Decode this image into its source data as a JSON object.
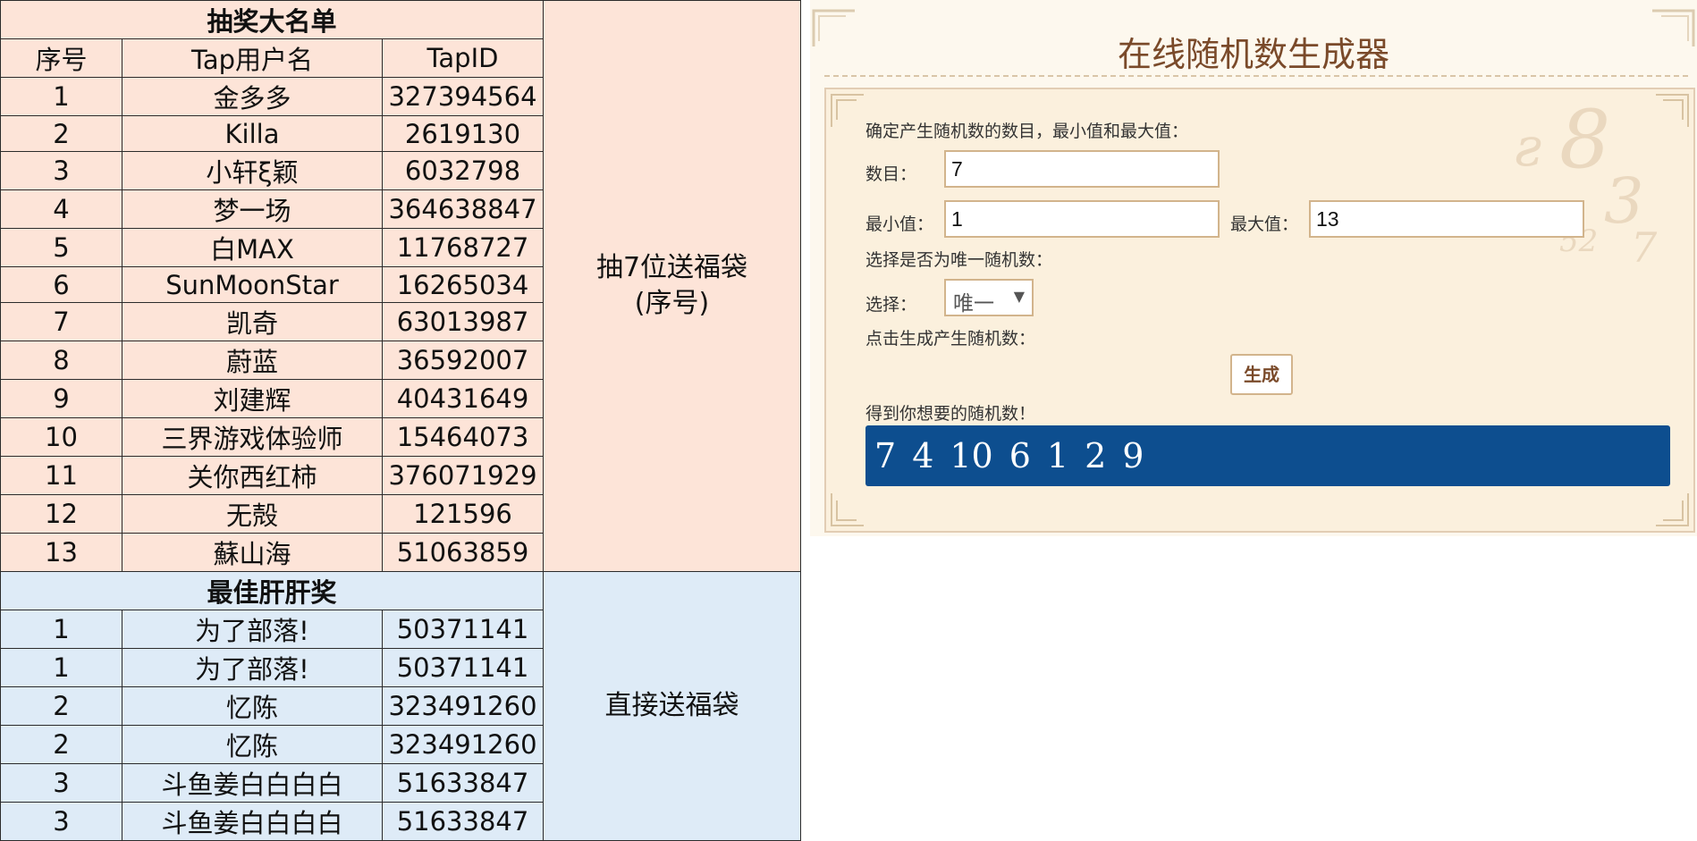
{
  "sheet": {
    "lottery_title": "抽奖大名单",
    "headers": [
      "序号",
      "Tap用户名",
      "TapID"
    ],
    "lottery_note_line1": "抽7位送福袋",
    "lottery_note_line2": "(序号)",
    "lottery_rows": [
      [
        "1",
        "金多多",
        "327394564"
      ],
      [
        "2",
        "Killa",
        "2619130"
      ],
      [
        "3",
        "小轩ξ颖",
        "6032798"
      ],
      [
        "4",
        "梦一场",
        "364638847"
      ],
      [
        "5",
        "白MAX",
        "11768727"
      ],
      [
        "6",
        "SunMoonStar",
        "16265034"
      ],
      [
        "7",
        "凯奇",
        "63013987"
      ],
      [
        "8",
        "蔚蓝",
        "36592007"
      ],
      [
        "9",
        "刘建辉",
        "40431649"
      ],
      [
        "10",
        "三界游戏体验师",
        "15464073"
      ],
      [
        "11",
        "关你西红柿",
        "376071929"
      ],
      [
        "12",
        "无殻",
        "121596"
      ],
      [
        "13",
        "蘇山海",
        "51063859"
      ]
    ],
    "best_title": "最佳肝肝奖",
    "best_note": "直接送福袋",
    "best_rows": [
      [
        "1",
        "为了部落!",
        "50371141"
      ],
      [
        "1",
        "为了部落!",
        "50371141"
      ],
      [
        "2",
        "忆陈",
        "323491260"
      ],
      [
        "2",
        "忆陈",
        "323491260"
      ],
      [
        "3",
        "斗鱼姜白白白白",
        "51633847"
      ],
      [
        "3",
        "斗鱼姜白白白白",
        "51633847"
      ]
    ]
  },
  "generator": {
    "title": "在线随机数生成器",
    "intro_label": "确定产生随机数的数目，最小值和最大值：",
    "count_label": "数目：",
    "count_value": "7",
    "min_label": "最小值：",
    "min_value": "1",
    "max_label": "最大值：",
    "max_value": "13",
    "unique_label": "选择是否为唯一随机数：",
    "select_label": "选择：",
    "select_value": "唯一",
    "click_label": "点击生成产生随机数：",
    "button_label": "生成",
    "result_label": "得到你想要的随机数！",
    "results": [
      "7",
      "4",
      "10",
      "6",
      "1",
      "2",
      "9"
    ]
  },
  "colors": {
    "lottery_bg": "#fde4d8",
    "best_bg": "#deebf7",
    "result_bg": "#0d4e8f",
    "title_color": "#7a4a2a"
  }
}
